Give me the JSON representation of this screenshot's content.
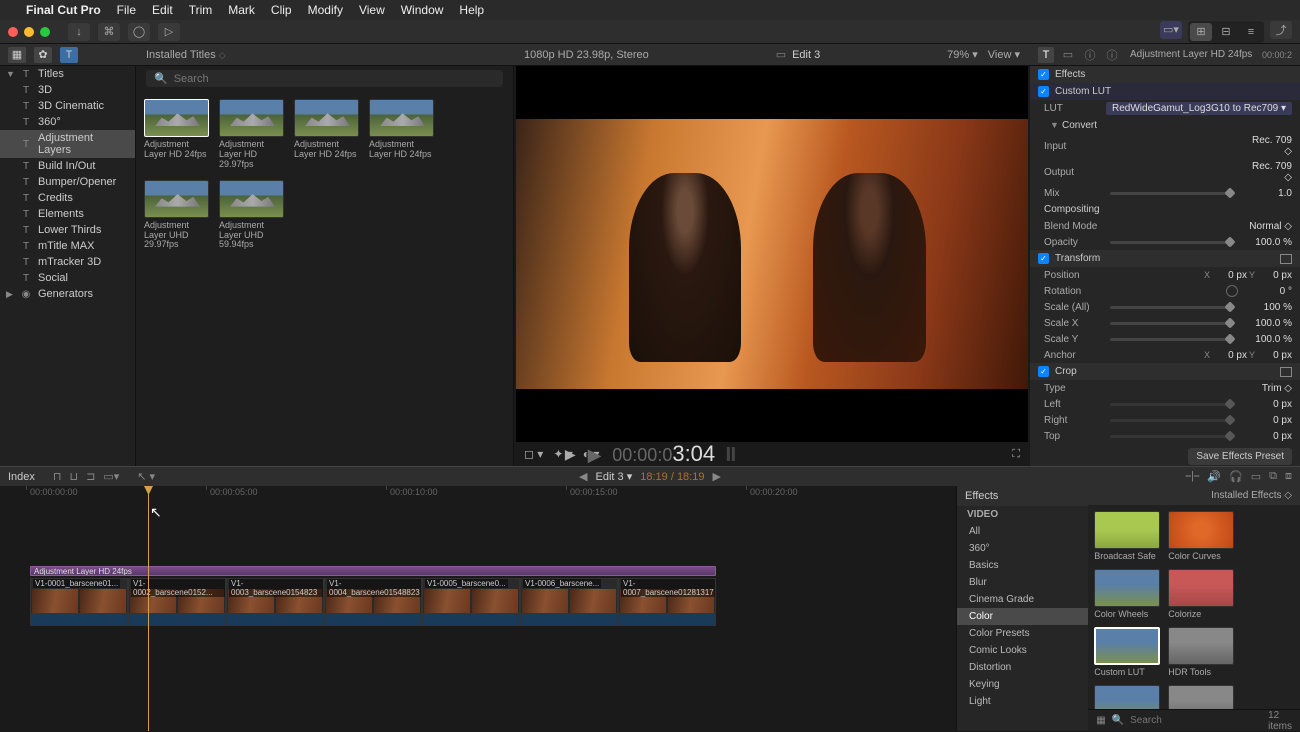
{
  "menubar": {
    "apple": "",
    "app": "Final Cut Pro",
    "items": [
      "File",
      "Edit",
      "Trim",
      "Mark",
      "Clip",
      "Modify",
      "View",
      "Window",
      "Help"
    ]
  },
  "browser_header": {
    "title": "Installed Titles"
  },
  "sidebar": {
    "titles_header": "Titles",
    "titles": [
      "3D",
      "3D Cinematic",
      "360°",
      "Adjustment Layers",
      "Build In/Out",
      "Bumper/Opener",
      "Credits",
      "Elements",
      "Lower Thirds",
      "mTitle MAX",
      "mTracker 3D",
      "Social"
    ],
    "titles_selected": 3,
    "generators_header": "Generators"
  },
  "browser": {
    "search_placeholder": "Search",
    "items": [
      {
        "label": "Adjustment Layer HD 24fps"
      },
      {
        "label": "Adjustment Layer HD 29.97fps"
      },
      {
        "label": "Adjustment Layer HD 24fps"
      },
      {
        "label": "Adjustment Layer HD 24fps"
      },
      {
        "label": "Adjustment Layer UHD 29.97fps"
      },
      {
        "label": "Adjustment Layer UHD 59.94fps"
      }
    ],
    "selected": 0
  },
  "viewer": {
    "spec": "1080p HD 23.98p, Stereo",
    "name": "Edit 3",
    "zoom": "79%",
    "view_label": "View",
    "timecode_dim": "00:00:0",
    "timecode_big": "3:04"
  },
  "inspector": {
    "title": "Adjustment Layer HD 24fps",
    "duration": "00:00:2",
    "effects_hdr": "Effects",
    "custom_lut_hdr": "Custom LUT",
    "lut_label": "LUT",
    "lut_value": "RedWideGamut_Log3G10 to Rec709",
    "convert_hdr": "Convert",
    "input_label": "Input",
    "input_value": "Rec. 709",
    "output_label": "Output",
    "output_value": "Rec. 709",
    "mix_label": "Mix",
    "mix_value": "1.0",
    "compositing_hdr": "Compositing",
    "blend_label": "Blend Mode",
    "blend_value": "Normal",
    "opacity_label": "Opacity",
    "opacity_value": "100.0 %",
    "transform_hdr": "Transform",
    "position_label": "Position",
    "pos_x": "0 px",
    "pos_y": "0 px",
    "rotation_label": "Rotation",
    "rotation_value": "0 °",
    "scale_all_label": "Scale (All)",
    "scale_all_value": "100 %",
    "scale_x_label": "Scale X",
    "scale_x_value": "100.0 %",
    "scale_y_label": "Scale Y",
    "scale_y_value": "100.0 %",
    "anchor_label": "Anchor",
    "anchor_x": "0 px",
    "anchor_y": "0 px",
    "crop_hdr": "Crop",
    "crop_type_label": "Type",
    "crop_type_value": "Trim",
    "crop_left_label": "Left",
    "crop_left_value": "0 px",
    "crop_right_label": "Right",
    "crop_right_value": "0 px",
    "crop_top_label": "Top",
    "crop_top_value": "0 px",
    "save_preset": "Save Effects Preset"
  },
  "timeline_hdr": {
    "index": "Index",
    "name": "Edit 3",
    "range": "18:19 / 18:19"
  },
  "timeline": {
    "ruler": [
      "00:00:00:00",
      "00:00:05:00",
      "00:00:10:00",
      "00:00:15:00",
      "00:00:20:00"
    ],
    "adj_label": "Adjustment Layer HD 24fps",
    "clips": [
      "V1-0001_barscene01...",
      "V1-0002_barscene0152...",
      "V1-0003_barscene0154823",
      "V1-0004_barscene01548823",
      "V1-0005_barscene0...",
      "V1-0006_barscene...",
      "V1-0007_barscene01281317"
    ]
  },
  "effects": {
    "header": "Effects",
    "installed": "Installed Effects",
    "video_hdr": "VIDEO",
    "cats": [
      "All",
      "360°",
      "Basics",
      "Blur",
      "Cinema Grade",
      "Color",
      "Color Presets",
      "Comic Looks",
      "Distortion",
      "Keying",
      "Light"
    ],
    "cats_selected": 5,
    "items": [
      {
        "label": "Broadcast Safe",
        "bg": "bg-broadcast"
      },
      {
        "label": "Color Curves",
        "bg": "bg-curves"
      },
      {
        "label": "Color Wheels",
        "bg": "bg-wheels"
      },
      {
        "label": "Colorize",
        "bg": "bg-colorize"
      },
      {
        "label": "Custom LUT",
        "bg": "bg-custom"
      },
      {
        "label": "HDR Tools",
        "bg": "bg-hdr"
      },
      {
        "label": "",
        "bg": "bg-wheels"
      },
      {
        "label": "",
        "bg": "bg-hdr"
      }
    ],
    "selected": 4,
    "search_placeholder": "Search",
    "count": "12 items"
  }
}
